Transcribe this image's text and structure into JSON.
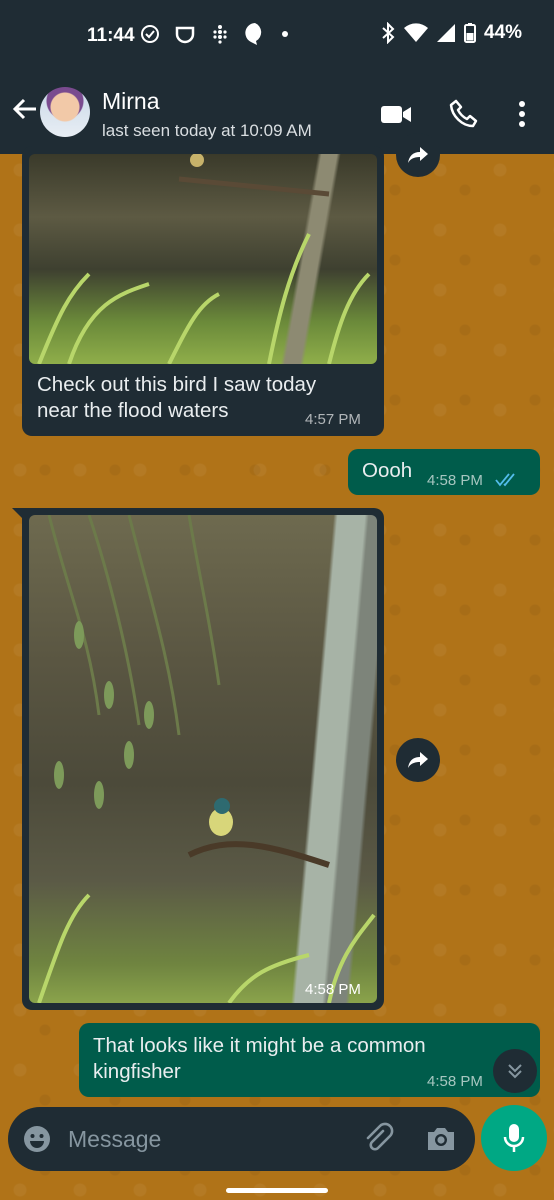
{
  "status_bar": {
    "time": "11:44",
    "battery": "44%"
  },
  "header": {
    "contact_name": "Mirna",
    "last_seen": "last seen today at 10:09 AM"
  },
  "messages": [
    {
      "direction": "incoming",
      "type": "image",
      "caption": "Check out this bird I saw today near the flood waters",
      "time": "4:57 PM"
    },
    {
      "direction": "outgoing",
      "type": "text",
      "text": "Oooh",
      "time": "4:58 PM",
      "status": "read"
    },
    {
      "direction": "incoming",
      "type": "image",
      "time": "4:58 PM"
    },
    {
      "direction": "outgoing",
      "type": "text",
      "text": "That looks like it might be a common kingfisher",
      "time": "4:58 PM"
    }
  ],
  "composer": {
    "placeholder": "Message"
  },
  "colors": {
    "bar": "#1f2c34",
    "outgoing_bubble": "#005c4b",
    "incoming_bubble": "#1f2c34",
    "accent": "#00a884",
    "read_ticks": "#53bdeb",
    "wallpaper": "#b07318"
  },
  "icons": {
    "back": "arrow-left-icon",
    "video": "video-call-icon",
    "call": "phone-icon",
    "menu": "more-vert-icon",
    "forward": "forward-icon",
    "emoji": "emoji-icon",
    "attach": "paperclip-icon",
    "camera": "camera-icon",
    "mic": "mic-icon",
    "scroll_down": "double-chevron-down-icon"
  }
}
